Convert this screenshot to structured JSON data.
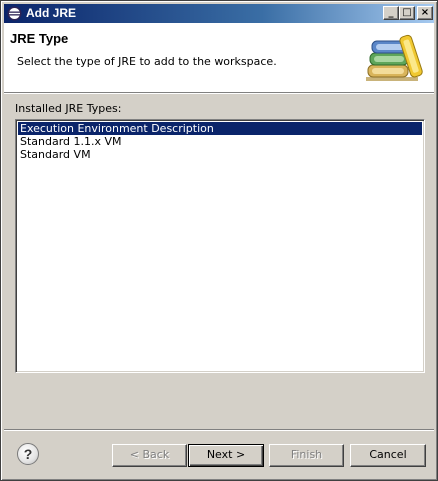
{
  "window": {
    "title": "Add JRE",
    "icon": "eclipse-icon",
    "controls": {
      "minimize": "_",
      "maximize": "□",
      "close": "×"
    }
  },
  "header": {
    "title": "JRE Type",
    "description": "Select the type of JRE to add to the workspace.",
    "banner_icon": "books-icon"
  },
  "list": {
    "label": "Installed JRE Types:",
    "items": [
      {
        "label": "Execution Environment Description",
        "selected": true
      },
      {
        "label": "Standard 1.1.x VM",
        "selected": false
      },
      {
        "label": "Standard VM",
        "selected": false
      }
    ]
  },
  "footer": {
    "help": "?",
    "back_label": "< Back",
    "next_label": "Next >",
    "finish_label": "Finish",
    "cancel_label": "Cancel"
  },
  "colors": {
    "titlebar_start": "#0a246a",
    "titlebar_end": "#a6caf0",
    "selection": "#0a246a",
    "dialog_bg": "#d4d0c8"
  }
}
